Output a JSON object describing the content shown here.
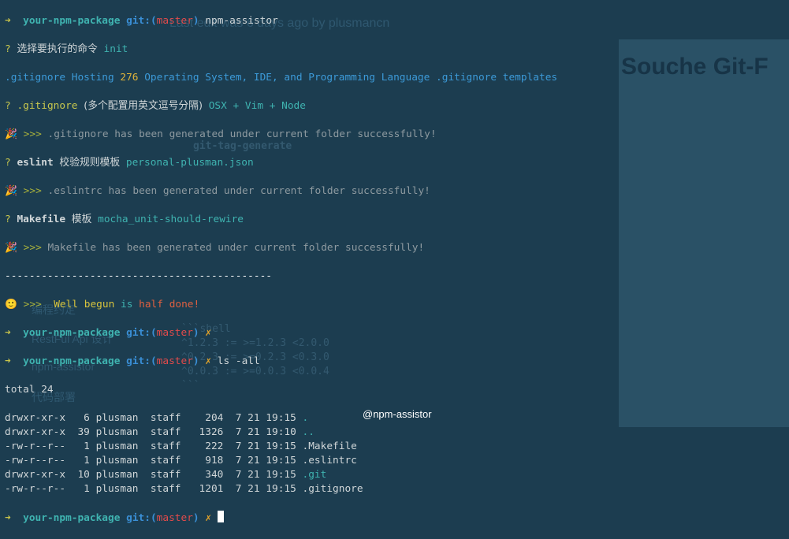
{
  "background_page": {
    "edit_note": "Last edit was 6 days ago by plusmancn",
    "title": "Souche Git-F",
    "section": "git-tag-generate",
    "sidebar": [
      "编程约定",
      "RestFul Api 设计",
      "npm-assistor",
      "代码部署"
    ],
    "code": [
      "```shell",
      "^1.2.3 := >=1.2.3 <2.0.0",
      "^0.2.3 := >=0.2.3 <0.3.0",
      "^0.0.3 := >=0.0.3 <0.0.4",
      "```"
    ]
  },
  "prompt": {
    "arrow": "➜",
    "dir": "your-npm-package",
    "git_open": "git:(",
    "branch": "master",
    "git_close": ")",
    "dirty": "✗"
  },
  "lines": {
    "cmd1": "npm-assistor",
    "q1_label": "选择要执行的命令",
    "q1_answer": "init",
    "gi_a": ".gitignore Hosting ",
    "gi_num": "276",
    "gi_b": " Operating System, IDE, and Programming Language .gitignore templates",
    "q2_label": ".gitignore",
    "q2_hint": "(多个配置用英文逗号分隔)",
    "q2_answer": "OSX + Vim + Node",
    "ok1": ".gitignore has been generated under current folder successfully!",
    "q3_label": "eslint",
    "q3_hint": "校验规则模板",
    "q3_answer": "personal-plusman.json",
    "ok2": ".eslintrc has been generated under current folder successfully!",
    "q4_label": "Makefile",
    "q4_hint": "模板",
    "q4_answer": "mocha_unit-should-rewire",
    "ok3": "Makefile has been generated under current folder successfully!",
    "divider": "--------------------------------------------",
    "done_w1": "Well",
    "done_w2": "begun",
    "done_w3": "is",
    "done_w4": "half",
    "done_w5": "done!",
    "cmd2": "ls -all",
    "total": "total 24",
    "question_mark": "?",
    "chevrons": ">>>",
    "party": "🎉",
    "smile": "🙂"
  },
  "ls": [
    {
      "perm": "drwxr-xr-x",
      "links": "6",
      "user": "plusman",
      "group": "staff",
      "size": "204",
      "date": "7 21 19:15",
      "name": "."
    },
    {
      "perm": "drwxr-xr-x",
      "links": "39",
      "user": "plusman",
      "group": "staff",
      "size": "1326",
      "date": "7 21 19:10",
      "name": ".."
    },
    {
      "perm": "-rw-r--r--",
      "links": "1",
      "user": "plusman",
      "group": "staff",
      "size": "222",
      "date": "7 21 19:15",
      "name": ".Makefile"
    },
    {
      "perm": "-rw-r--r--",
      "links": "1",
      "user": "plusman",
      "group": "staff",
      "size": "918",
      "date": "7 21 19:15",
      "name": ".eslintrc"
    },
    {
      "perm": "drwxr-xr-x",
      "links": "10",
      "user": "plusman",
      "group": "staff",
      "size": "340",
      "date": "7 21 19:15",
      "name": ".git"
    },
    {
      "perm": "-rw-r--r--",
      "links": "1",
      "user": "plusman",
      "group": "staff",
      "size": "1201",
      "date": "7 21 19:15",
      "name": ".gitignore"
    }
  ],
  "watermark": "@npm-assistor"
}
